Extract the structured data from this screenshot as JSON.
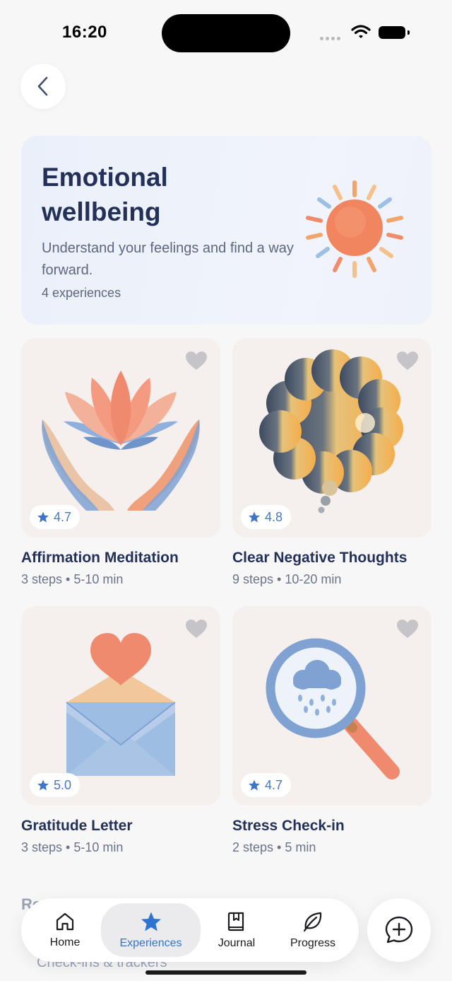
{
  "status": {
    "time": "16:20"
  },
  "hero": {
    "title": "Emotional wellbeing",
    "description": "Understand your feelings and find a way forward.",
    "count": "4 experiences"
  },
  "cards": [
    {
      "title": "Affirmation Meditation",
      "meta": "3 steps • 5-10 min",
      "rating": "4.7"
    },
    {
      "title": "Clear Negative Thoughts",
      "meta": "9 steps • 10-20 min",
      "rating": "4.8"
    },
    {
      "title": "Gratitude Letter",
      "meta": "3 steps • 5-10 min",
      "rating": "5.0"
    },
    {
      "title": "Stress Check-in",
      "meta": "2 steps • 5 min",
      "rating": "4.7"
    }
  ],
  "peek": {
    "section": "Re",
    "sub": "Check-ins & trackers"
  },
  "nav": {
    "home": "Home",
    "experiences": "Experiences",
    "journal": "Journal",
    "progress": "Progress"
  },
  "icons": {
    "back": "chevron-left-icon",
    "favorite": "heart-icon",
    "rating": "star-icon",
    "home": "house-icon",
    "experiences": "star-icon",
    "journal": "book-bookmark-icon",
    "progress": "leaf-icon",
    "fab": "chat-plus-icon"
  },
  "colors": {
    "accent": "#2f74d0",
    "title": "#233158",
    "rating": "#4a78c0"
  }
}
